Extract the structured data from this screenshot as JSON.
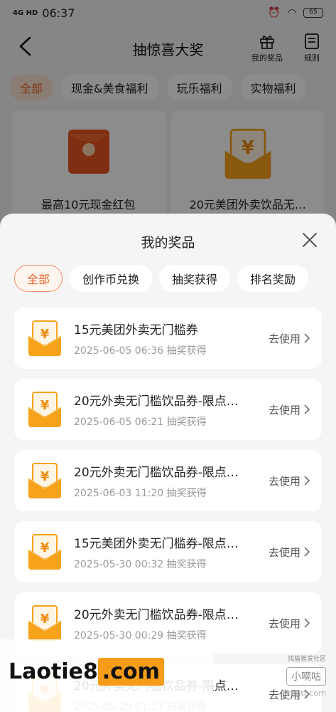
{
  "status_bar": {
    "signal": "4G HD",
    "time": "06:37",
    "battery": "65"
  },
  "page": {
    "title": "抽惊喜大奖",
    "my_prizes_label": "我的奖品",
    "rules_label": "规则"
  },
  "categories": [
    {
      "label": "全部",
      "active": true
    },
    {
      "label": "现金&美食福利",
      "active": false
    },
    {
      "label": "玩乐福利",
      "active": false
    },
    {
      "label": "实物福利",
      "active": false
    }
  ],
  "prize_cards": [
    {
      "caption": "最高10元现金红包",
      "icon": "red-envelope-icon"
    },
    {
      "caption": "20元美团外卖饮品无…",
      "icon": "yuan-coupon-icon"
    }
  ],
  "sheet": {
    "title": "我的奖品",
    "filters": [
      {
        "label": "全部",
        "active": true
      },
      {
        "label": "创作币兑换",
        "active": false
      },
      {
        "label": "抽奖获得",
        "active": false
      },
      {
        "label": "排名奖励",
        "active": false
      }
    ],
    "items": [
      {
        "title": "15元美团外卖无门槛券",
        "meta": "2025-06-05 06:36 抽奖获得",
        "action": "去使用"
      },
      {
        "title": "20元外卖无门槛饮品券-限点…",
        "meta": "2025-06-05 06:21 抽奖获得",
        "action": "去使用"
      },
      {
        "title": "20元外卖无门槛饮品券-限点…",
        "meta": "2025-06-03 11:20 抽奖获得",
        "action": "去使用"
      },
      {
        "title": "15元美团外卖无门槛券-限点…",
        "meta": "2025-05-30 00:32 抽奖获得",
        "action": "去使用"
      },
      {
        "title": "20元外卖无门槛饮品券-限点…",
        "meta": "2025-05-30 00:29 抽奖获得",
        "action": "去使用"
      },
      {
        "title": "20元外卖无门槛饮品券-限点…",
        "meta": "2025-05-29 01:57 抽奖获得",
        "action": "去使用"
      }
    ]
  },
  "watermark": {
    "main_prefix": "Laotie8",
    "main_suffix": ".com",
    "small_text": "找猫首发社区",
    "badge": "小嘀咕",
    "site": "xdgtt.com"
  },
  "colors": {
    "accent": "#e8632a",
    "coupon": "#f7a21b"
  }
}
